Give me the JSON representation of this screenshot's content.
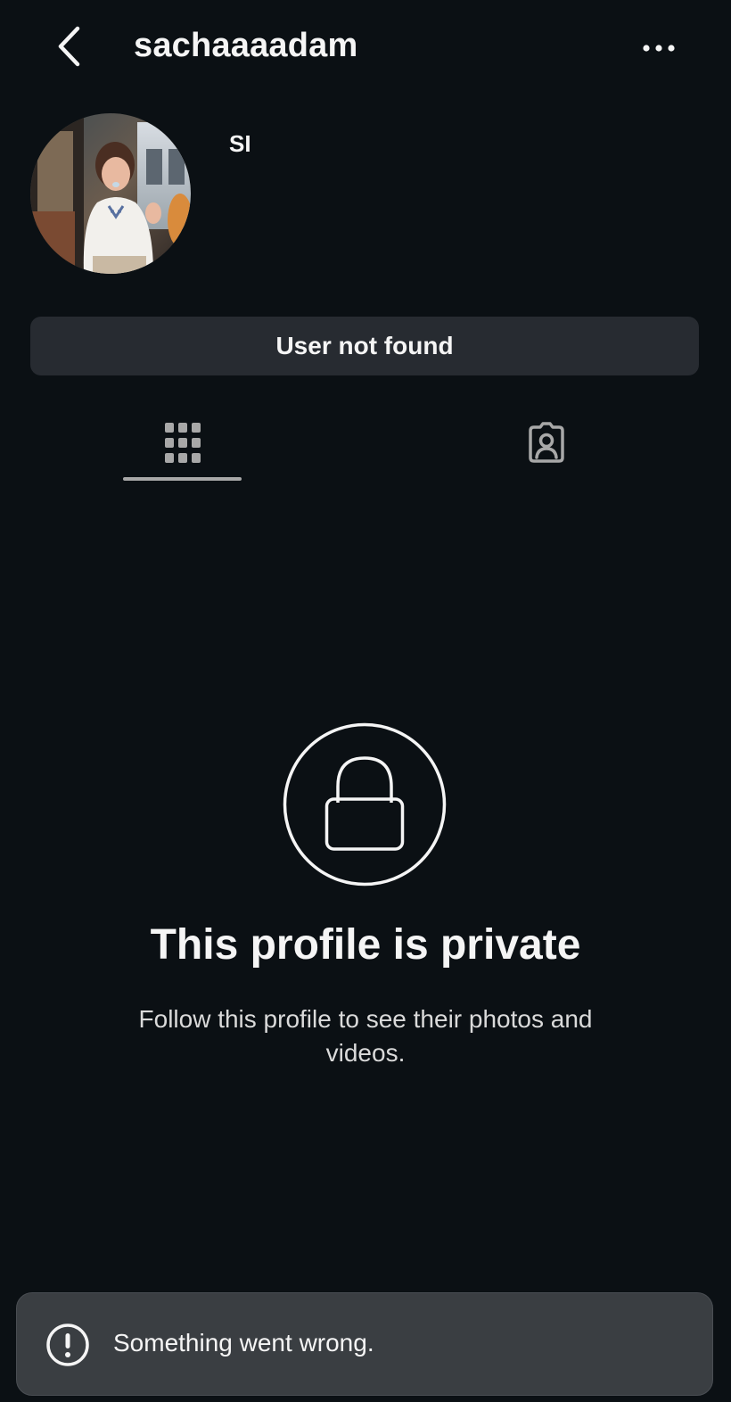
{
  "header": {
    "username": "sachaaaadam",
    "back_icon": "chevron-left-icon",
    "more_icon": "more-horizontal-icon"
  },
  "profile": {
    "display_name": "SI",
    "avatar_alt": "profile-photo"
  },
  "status_button": {
    "label": "User not found"
  },
  "tabs": [
    {
      "name": "grid",
      "icon": "grid-icon",
      "selected": true
    },
    {
      "name": "tagged",
      "icon": "tagged-person-icon",
      "selected": false
    }
  ],
  "private_notice": {
    "icon": "lock-icon",
    "title": "This profile is private",
    "subtitle": "Follow this profile to see their photos and videos."
  },
  "toast": {
    "icon": "alert-circle-icon",
    "message": "Something went wrong."
  },
  "colors": {
    "background": "#0b1014",
    "button": "#272b31",
    "toast": "#3a3e42",
    "text": "#f5f5f5"
  }
}
